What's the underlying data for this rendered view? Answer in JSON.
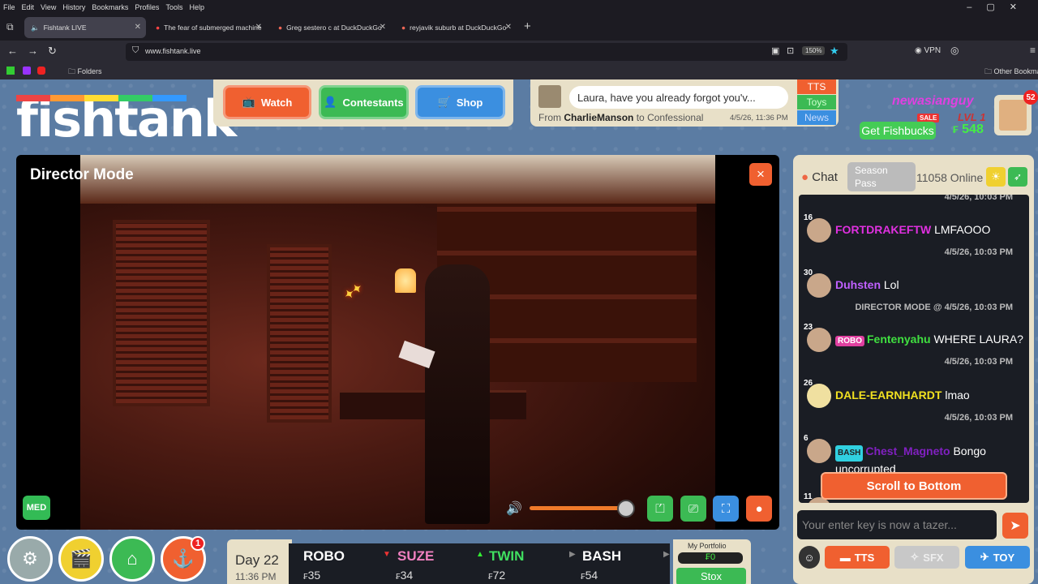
{
  "browser": {
    "menu": [
      "File",
      "Edit",
      "View",
      "History",
      "Bookmarks",
      "Profiles",
      "Tools",
      "Help"
    ],
    "tabs": [
      {
        "title": "Fishtank LIVE",
        "active": true
      },
      {
        "title": "The fear of submerged machine"
      },
      {
        "title": "Greg sestero c at DuckDuckGo"
      },
      {
        "title": "reyjavik suburb at DuckDuckGo"
      }
    ],
    "new_tab": "+",
    "url": "www.fishtank.live",
    "zoom": "150%",
    "vpn": "VPN",
    "bookmarks": {
      "folders": "Folders",
      "other": "Other Bookmar"
    }
  },
  "site": {
    "logo": "fishtank",
    "logo_mark": "©",
    "nav": {
      "watch": "Watch",
      "contestants": "Contestants",
      "shop": "Shop"
    },
    "notice": {
      "text": "Laura, have you already forgot you'v...",
      "from_label": "From",
      "from": "CharlieManson",
      "to_label": "to",
      "to": "Confessional",
      "time": "4/5/26, 11:36 PM"
    },
    "side_tabs": [
      "TTS",
      "Toys",
      "News"
    ],
    "user": {
      "name": "newasianguy",
      "sale": "SALE",
      "level": "LVL 1",
      "fishbucks_label": "Get Fishbucks",
      "balance": "548",
      "currency": "₣",
      "notifications": "52"
    }
  },
  "player": {
    "title": "Director Mode",
    "close": "×",
    "quality": "MED",
    "volume": 0.95
  },
  "chat": {
    "label": "Chat",
    "season_pass": "Season Pass",
    "online": "11058 Online",
    "top_time": "4/5/26, 10:03 PM",
    "messages": [
      {
        "level": "16",
        "user": "FORTDRAKEFTW",
        "text": "LMFAOOO",
        "color": "#e030e0",
        "time": "4/5/26, 10:03 PM"
      },
      {
        "level": "30",
        "user": "Duhsten",
        "text": "Lol",
        "color": "#c060ff",
        "time": "DIRECTOR MODE @ 4/5/26, 10:03 PM"
      },
      {
        "level": "23",
        "tag": "ROBO",
        "tag_color": "#e040a0",
        "user": "Fentenyahu",
        "text": "WHERE LAURA?",
        "color": "#40e040",
        "time": "4/5/26, 10:03 PM"
      },
      {
        "level": "26",
        "user": "DALE-EARNHARDT",
        "text": "lmao",
        "color": "#f0e020",
        "time": "4/5/26, 10:03 PM"
      },
      {
        "level": "6",
        "tag": "BASH",
        "tag_color": "#30d0e0",
        "user": "Chest_Magneto",
        "text": "Bongo uncorrupted",
        "color": "#8020c0",
        "time": ""
      }
    ],
    "partial_level": "11",
    "scroll_bottom": "Scroll to Bottom",
    "input_placeholder": "Your enter key is now a tazer...",
    "buttons": {
      "tts": "TTS",
      "sfx": "SFX",
      "toy": "TOY"
    }
  },
  "bottom": {
    "alert_badge": "1",
    "day": "Day 22",
    "time": "11:36 PM",
    "stocks": [
      {
        "name": "ROBO",
        "price": "35",
        "trend": "none",
        "color": "#ffffff"
      },
      {
        "name": "SUZE",
        "price": "34",
        "trend": "down",
        "color": "#f080c0"
      },
      {
        "name": "TWIN",
        "price": "72",
        "trend": "up",
        "color": "#40e060"
      },
      {
        "name": "BASH",
        "price": "54",
        "trend": "flat",
        "color": "#ffffff"
      }
    ],
    "portfolio_label": "My Portfolio",
    "portfolio_value": "₣0",
    "stox": "Stox"
  }
}
